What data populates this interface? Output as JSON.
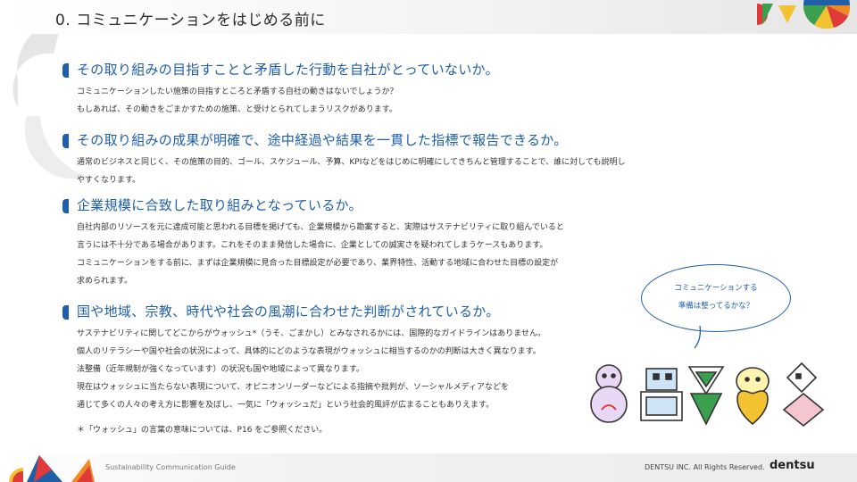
{
  "header": {
    "title": "0. コミュニケーションをはじめる前に"
  },
  "sections": [
    {
      "title": "その取り組みの目指すことと矛盾した行動を自社がとっていないか。",
      "lines": [
        "コミュニケーションしたい施策の目指すところと矛盾する自社の動きはないでしょうか？",
        "もしあれば、その動きをごまかすための施策、と受けとられてしまうリスクがあります。"
      ]
    },
    {
      "title": "その取り組みの成果が明確で、途中経過や結果を一貫した指標で報告できるか。",
      "lines": [
        "通常のビジネスと同じく、その施策の目的、ゴール、スケジュール、予算、KPIなどをはじめに明確にしてきちんと管理することで、誰に対しても説明し",
        "やすくなります。"
      ]
    },
    {
      "title": "企業規模に合致した取り組みとなっているか。",
      "lines": [
        "自社内部のリソースを元に達成可能と思われる目標を掲げても、企業規模から勘案すると、実際はサステナビリティに取り組んでいると",
        "言うには不十分である場合があります。これをそのまま発信した場合に、企業としての誠実さを疑われてしまうケースもあります。",
        "コミュニケーションをする前に、まずは企業規模に見合った目標設定が必要であり、業界特性、活動する地域に合わせた目標の設定が",
        "求められます。"
      ]
    },
    {
      "title": "国や地域、宗教、時代や社会の風潮に合わせた判断がされているか。",
      "lines": [
        "サステナビリティに関してどこからがウォッシュ*（うそ、ごまかし）とみなされるかには、国際的なガイドラインはありません。",
        "個人のリテラシーや国や社会の状況によって、具体的にどのような表現がウォッシュに相当するのかの判断は大きく異なります。",
        "法整備（近年規制が強くなっています）の状況も国や地域によって異なります。",
        "現在はウォッシュに当たらない表現について、オピニオンリーダーなどによる指摘や批判が、ソーシャルメディアなどを",
        "通じて多くの人々の考え方に影響を及ぼし、一気に「ウォッシュだ」という社会的風評が広まることもありえます。"
      ]
    }
  ],
  "footnote": "＊「ウォッシュ」の言葉の意味については、P16 をご参照ください。",
  "bubble": {
    "line1": "コミュニケーションする",
    "line2": "準備は整ってるかな？"
  },
  "footer": {
    "guide": "Sustainability Communication Guide",
    "copyright": "DENTSU INC. All Rights Reserved.",
    "brand": "dentsu"
  },
  "colors": {
    "accent": "#1f5fa8",
    "red": "#e03a3a",
    "yellow": "#f2c230",
    "green": "#3aa050",
    "blue": "#1f5fa8",
    "orange": "#f08a24"
  }
}
